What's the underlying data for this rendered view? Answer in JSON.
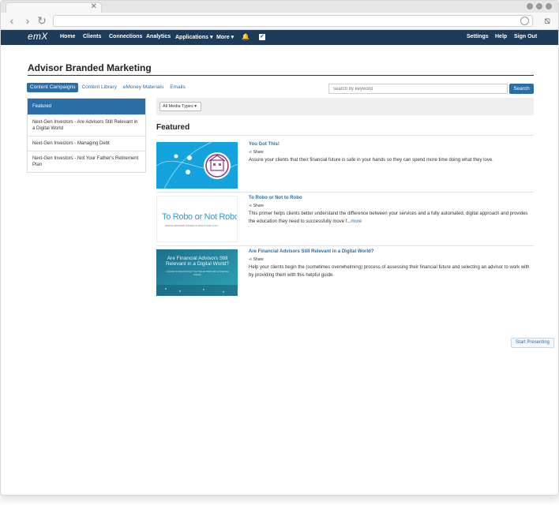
{
  "app": {
    "logo": "emX"
  },
  "nav": {
    "home": "Home",
    "clients": "Clients",
    "connections": "Connections",
    "analytics": "Analytics",
    "applications": "Applications ▾",
    "more": "More ▾",
    "settings": "Settings",
    "help": "Help",
    "sign_out": "Sign Out"
  },
  "page": {
    "title": "Advisor Branded Marketing",
    "tabs": [
      "Content Campaigns",
      "Content Library",
      "eMoney Materials",
      "Emails"
    ],
    "search_placeholder": "search by keyword",
    "search_button": "Search",
    "filter_select": "All Media Types ▾",
    "section_title": "Featured",
    "start_presenting": "Start Presenting"
  },
  "sidebar": {
    "items": [
      "Featured",
      "Next-Gen Investors - Are Advisors Still Relevant in a Digital World",
      "Next-Gen Investors - Managing Debt",
      "Next-Gen Investors - Not Your Father's Retirement Plan"
    ]
  },
  "items": [
    {
      "title": "You Got This!",
      "share": "Share",
      "desc": "Assure your clients that their financial future is safe in your hands so they can spend more time doing what they love.",
      "more": ""
    },
    {
      "title": "To Robo or Not to Robo",
      "share": "Share",
      "desc": "This primer helps clients better understand the difference between your services and a fully automated, digital approach and provides the education they need to successfully move f...",
      "more": "more",
      "thumb_title": "To Robo or Not Robo",
      "thumb_sub": "WHICH ADVISORY MODEL IS RIGHT FOR YOU?"
    },
    {
      "title": "Are Financial Advisors Still Relevant in a Digital World?",
      "share": "Share",
      "desc": "Help your clients begin the (sometimes overwhelming) process of assessing their financial future and selecting an advisor to work with by providing them with this helpful guide.",
      "more": "",
      "thumb_title": "Are Financial Advisors Still Relevant in a Digital World?",
      "thumb_sub": "A Guide to Determining If You Should Work with a Financial Advisor"
    }
  ]
}
